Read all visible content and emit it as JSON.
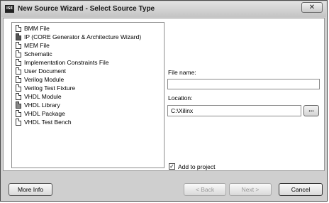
{
  "window": {
    "title": "New Source Wizard - Select Source Type",
    "app_icon_text": "ISE",
    "close_label": "✕"
  },
  "source_types": [
    {
      "label": "BMM File",
      "icon": "file-icon"
    },
    {
      "label": "IP (CORE Generator & Architecture Wizard)",
      "icon": "ip-core-icon"
    },
    {
      "label": "MEM File",
      "icon": "file-icon"
    },
    {
      "label": "Schematic",
      "icon": "schematic-icon"
    },
    {
      "label": "Implementation Constraints File",
      "icon": "file-icon"
    },
    {
      "label": "User Document",
      "icon": "document-icon"
    },
    {
      "label": "Verilog Module",
      "icon": "file-icon"
    },
    {
      "label": "Verilog Test Fixture",
      "icon": "file-icon"
    },
    {
      "label": "VHDL Module",
      "icon": "file-icon"
    },
    {
      "label": "VHDL Library",
      "icon": "library-icon"
    },
    {
      "label": "VHDL Package",
      "icon": "file-icon"
    },
    {
      "label": "VHDL Test Bench",
      "icon": "file-icon"
    }
  ],
  "form": {
    "file_name_label": "File name:",
    "file_name_value": "",
    "location_label": "Location:",
    "location_value": "C:\\Xilinx",
    "browse_label": "...",
    "add_to_project_label": "Add to project",
    "add_to_project_checked": true,
    "check_mark": "✓"
  },
  "buttons": {
    "more_info": "More Info",
    "back": "< Back",
    "next": "Next >",
    "cancel": "Cancel"
  }
}
